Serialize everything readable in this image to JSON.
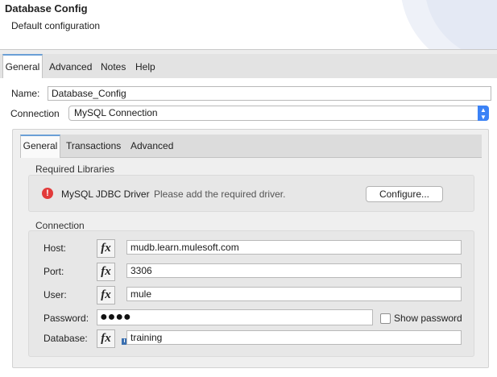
{
  "header": {
    "title": "Database Config",
    "subtitle": "Default configuration"
  },
  "tabs": [
    "General",
    "Advanced",
    "Notes",
    "Help"
  ],
  "form": {
    "name_label": "Name:",
    "name_value": "Database_Config",
    "connection_label": "Connection",
    "connection_value": "MySQL Connection"
  },
  "inner_tabs": [
    "General",
    "Transactions",
    "Advanced"
  ],
  "required_libraries": {
    "title": "Required Libraries",
    "driver_name": "MySQL JDBC Driver",
    "driver_message": "Please add the required driver.",
    "configure_button": "Configure..."
  },
  "connection": {
    "title": "Connection",
    "host_label": "Host:",
    "host_value": "mudb.learn.mulesoft.com",
    "port_label": "Port:",
    "port_value": "3306",
    "user_label": "User:",
    "user_value": "mule",
    "password_label": "Password:",
    "password_value": "●●●●",
    "show_password_label": "Show password",
    "database_label": "Database:",
    "database_value": "training",
    "fx_label": "fx"
  },
  "icons": {
    "error": "!",
    "info": "i",
    "dropdown": "▲▼"
  },
  "colors": {
    "accent": "#3b82f6",
    "error": "#e23b3b",
    "tab_highlight": "#6a9fd6"
  }
}
